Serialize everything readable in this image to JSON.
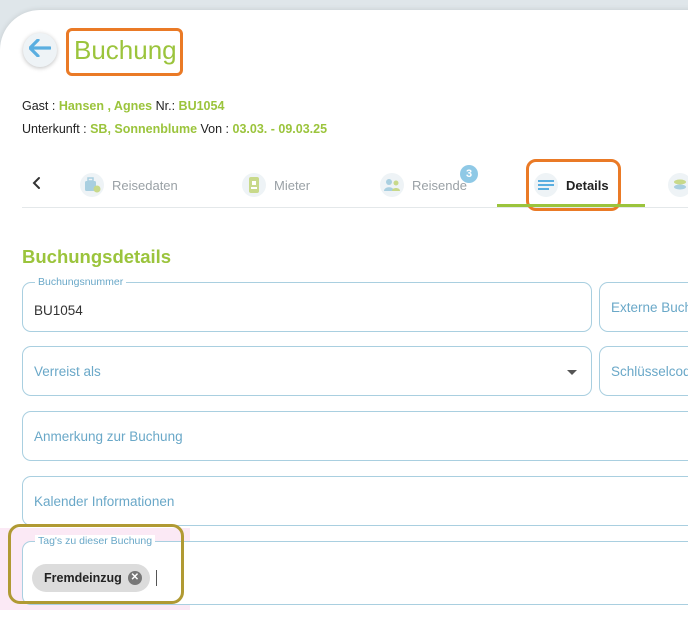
{
  "header": {
    "title": "Buchung"
  },
  "info": {
    "guest_label": "Gast : ",
    "guest_name": "Hansen , Agnes",
    "nr_label": " Nr.: ",
    "nr_value": "BU1054",
    "accommodation_label": "Unterkunft : ",
    "accommodation_value": "SB, Sonnenblume",
    "from_label": " Von : ",
    "from_value": "03.03. - 09.03.25"
  },
  "tabs": [
    {
      "label": "Reisedaten",
      "icon": "suitcase-icon"
    },
    {
      "label": "Mieter",
      "icon": "id-card-icon"
    },
    {
      "label": "Reisende",
      "icon": "people-icon",
      "badge": "3"
    },
    {
      "label": "Details",
      "icon": "list-icon",
      "active": true
    }
  ],
  "section": {
    "title": "Buchungsdetails"
  },
  "fields": {
    "booking_number": {
      "legend": "Buchungsnummer",
      "value": "BU1054"
    },
    "external_booking": {
      "placeholder": "Externe Buch"
    },
    "traveling_as": {
      "placeholder": "Verreist als"
    },
    "key_code": {
      "placeholder": "Schlüsselcod"
    },
    "booking_note": {
      "placeholder": "Anmerkung zur Buchung"
    },
    "calendar_info": {
      "placeholder": "Kalender Informationen"
    },
    "tags": {
      "legend": "Tag's zu dieser Buchung",
      "chips": [
        "Fremdeinzug"
      ]
    }
  },
  "colors": {
    "accent_green": "#9bc43c",
    "highlight_orange": "#ea7a26",
    "field_blue": "#a9cfe0"
  }
}
